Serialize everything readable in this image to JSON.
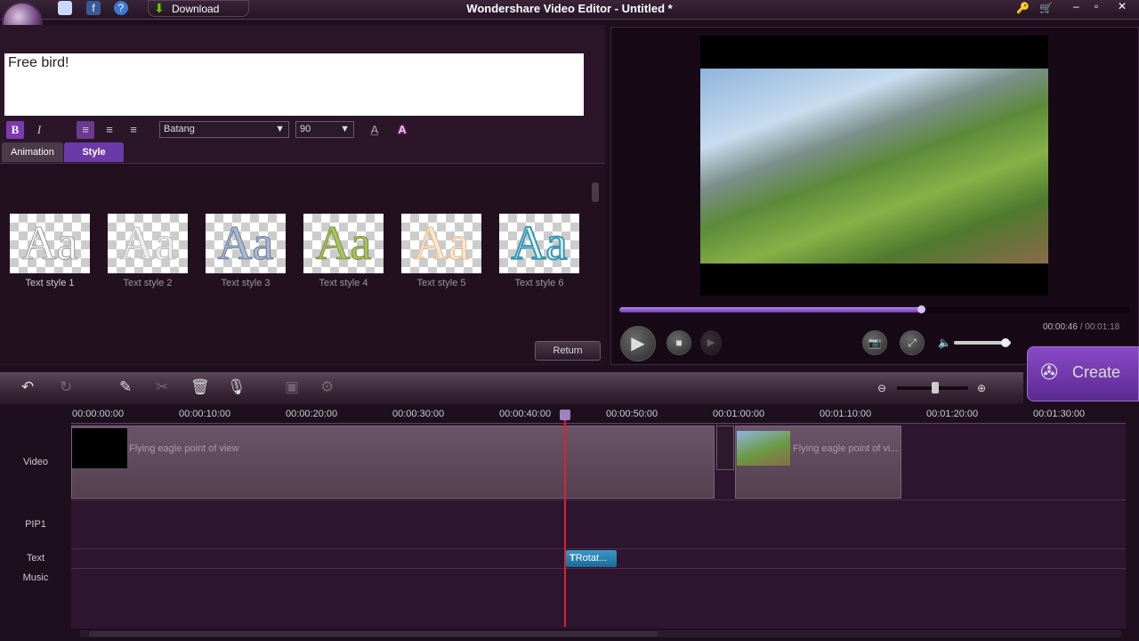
{
  "window": {
    "title": "Wondershare Video Editor - Untitled *",
    "download_label": "Download"
  },
  "editor": {
    "text": "Free bird!",
    "font": "Batang",
    "size": "90"
  },
  "tabs": [
    {
      "label": "Animation"
    },
    {
      "label": "Style",
      "active": true
    }
  ],
  "styles": [
    {
      "label": "Text style 1",
      "color": "#ffffff"
    },
    {
      "label": "Text style 2",
      "color": "#eeeeee"
    },
    {
      "label": "Text style 3",
      "color": "#a8b8d0"
    },
    {
      "label": "Text style 4",
      "color": "#a8c060"
    },
    {
      "label": "Text style 5",
      "color": "#f0d8b0"
    },
    {
      "label": "Text style 6",
      "color": "#50a8c0"
    }
  ],
  "return_label": "Return",
  "player": {
    "time": "00:00:46",
    "duration": "/ 00:01:18",
    "progress": 0.59,
    "volume": 0.9
  },
  "create_label": "Create",
  "ruler": [
    "00:00:00:00",
    "00:00:10:00",
    "00:00:20:00",
    "00:00:30:00",
    "00:00:40:00",
    "00:00:50:00",
    "00:01:00:00",
    "00:01:10:00",
    "00:01:20:00",
    "00:01:30:00"
  ],
  "tracks": {
    "video": "Video",
    "pip": "PIP1",
    "text": "Text",
    "music": "Music"
  },
  "clips": {
    "clip1": "Flying eagle point of view",
    "clip2": "Flying eagle point of vi...",
    "text_clip": "Rotat..."
  },
  "colors": {
    "accent": "#7a3ab0",
    "playhead": "#e02030"
  }
}
